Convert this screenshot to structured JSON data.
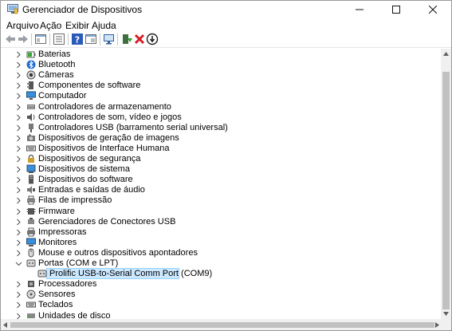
{
  "window": {
    "title": "Gerenciador de Dispositivos"
  },
  "menu": [
    "Arquivo",
    "Ação",
    "Exibir",
    "Ajuda"
  ],
  "toolbar": [
    {
      "name": "back-icon"
    },
    {
      "name": "forward-icon"
    },
    {
      "name": "properties-pane-icon"
    },
    {
      "name": "show-hide-tree-icon"
    },
    {
      "name": "help-icon"
    },
    {
      "name": "window-icon"
    },
    {
      "name": "scan-hardware-icon"
    },
    {
      "name": "update-driver-icon"
    },
    {
      "name": "uninstall-device-icon"
    },
    {
      "name": "disable-device-icon"
    }
  ],
  "tree": [
    {
      "label": "Baterias",
      "icon": "battery-icon",
      "state": "collapsed"
    },
    {
      "label": "Bluetooth",
      "icon": "bluetooth-icon",
      "state": "collapsed"
    },
    {
      "label": "Câmeras",
      "icon": "camera-icon",
      "state": "collapsed"
    },
    {
      "label": "Componentes de software",
      "icon": "software-component-icon",
      "state": "collapsed"
    },
    {
      "label": "Computador",
      "icon": "computer-icon",
      "state": "collapsed"
    },
    {
      "label": "Controladores de armazenamento",
      "icon": "storage-controller-icon",
      "state": "collapsed"
    },
    {
      "label": "Controladores de som, vídeo e jogos",
      "icon": "sound-icon",
      "state": "collapsed"
    },
    {
      "label": "Controladores USB (barramento serial universal)",
      "icon": "usb-icon",
      "state": "collapsed"
    },
    {
      "label": "Dispositivos de geração de imagens",
      "icon": "imaging-icon",
      "state": "collapsed"
    },
    {
      "label": "Dispositivos de Interface Humana",
      "icon": "hid-icon",
      "state": "collapsed"
    },
    {
      "label": "Dispositivos de segurança",
      "icon": "security-icon",
      "state": "collapsed"
    },
    {
      "label": "Dispositivos de sistema",
      "icon": "system-icon",
      "state": "collapsed"
    },
    {
      "label": "Dispositivos do software",
      "icon": "software-device-icon",
      "state": "collapsed"
    },
    {
      "label": "Entradas e saídas de áudio",
      "icon": "audio-io-icon",
      "state": "collapsed"
    },
    {
      "label": "Filas de impressão",
      "icon": "print-queue-icon",
      "state": "collapsed"
    },
    {
      "label": "Firmware",
      "icon": "firmware-icon",
      "state": "collapsed"
    },
    {
      "label": "Gerenciadores de Conectores USB",
      "icon": "usb-connector-icon",
      "state": "collapsed"
    },
    {
      "label": "Impressoras",
      "icon": "printer-icon",
      "state": "collapsed"
    },
    {
      "label": "Monitores",
      "icon": "monitor-icon",
      "state": "collapsed"
    },
    {
      "label": "Mouse e outros dispositivos apontadores",
      "icon": "mouse-icon",
      "state": "collapsed"
    },
    {
      "label": "Portas (COM e LPT)",
      "icon": "port-icon",
      "state": "expanded"
    },
    {
      "label": "Prolific USB-to-Serial Comm Port (COM9)",
      "icon": "port-device-icon",
      "state": "child",
      "selected": true
    },
    {
      "label": "Processadores",
      "icon": "processor-icon",
      "state": "collapsed"
    },
    {
      "label": "Sensores",
      "icon": "sensor-icon",
      "state": "collapsed"
    },
    {
      "label": "Teclados",
      "icon": "keyboard-icon",
      "state": "collapsed"
    },
    {
      "label": "Unidades de disco",
      "icon": "disk-drive-icon",
      "state": "collapsed"
    }
  ],
  "colors": {
    "selection_bg": "#cce8ff",
    "selection_border": "#99d1ff",
    "accent": "#0078d7"
  }
}
